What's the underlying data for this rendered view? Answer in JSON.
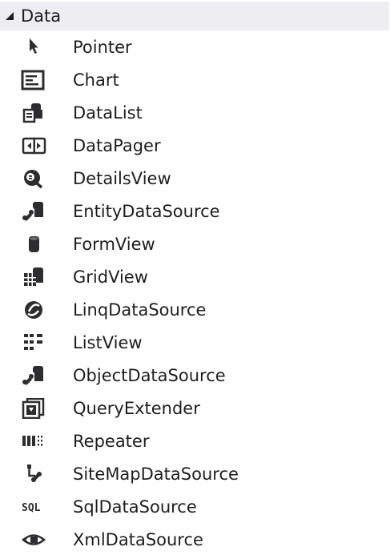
{
  "category": {
    "title": "Data",
    "expanded": true
  },
  "items": [
    {
      "label": "Pointer",
      "icon": "pointer-icon"
    },
    {
      "label": "Chart",
      "icon": "chart-icon"
    },
    {
      "label": "DataList",
      "icon": "datalist-icon"
    },
    {
      "label": "DataPager",
      "icon": "datapager-icon"
    },
    {
      "label": "DetailsView",
      "icon": "detailsview-icon"
    },
    {
      "label": "EntityDataSource",
      "icon": "entitydatasource-icon"
    },
    {
      "label": "FormView",
      "icon": "formview-icon"
    },
    {
      "label": "GridView",
      "icon": "gridview-icon"
    },
    {
      "label": "LinqDataSource",
      "icon": "linqdatasource-icon"
    },
    {
      "label": "ListView",
      "icon": "listview-icon"
    },
    {
      "label": "ObjectDataSource",
      "icon": "objectdatasource-icon"
    },
    {
      "label": "QueryExtender",
      "icon": "queryextender-icon"
    },
    {
      "label": "Repeater",
      "icon": "repeater-icon"
    },
    {
      "label": "SiteMapDataSource",
      "icon": "sitemapdatasource-icon"
    },
    {
      "label": "SqlDataSource",
      "icon": "sqldatasource-icon"
    },
    {
      "label": "XmlDataSource",
      "icon": "xmldatasource-icon"
    }
  ],
  "colors": {
    "header_bg": "#eeeef2",
    "icon": "#2d2d30",
    "text": "#1e1e1e"
  }
}
